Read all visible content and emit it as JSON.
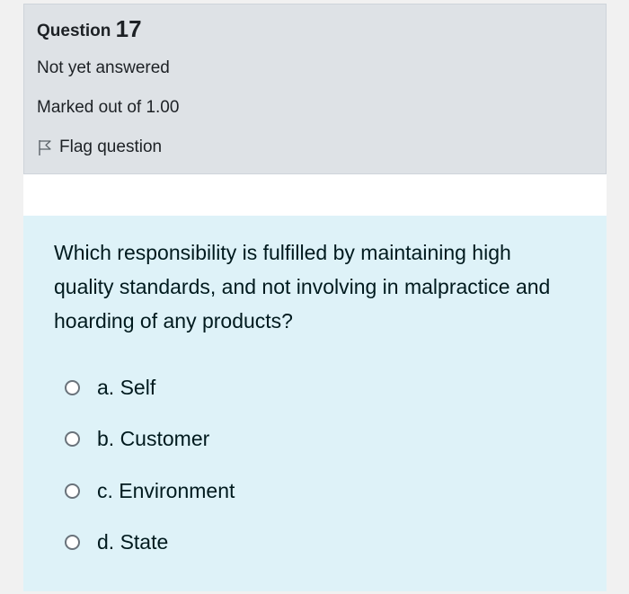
{
  "question": {
    "prefix": "Question",
    "number": "17",
    "state": "Not yet answered",
    "grade": "Marked out of 1.00",
    "flag_label": "Flag question"
  },
  "question_text": "Which responsibility is fulfilled by maintaining high quality standards, and not involving in malpractice and hoarding of any products?",
  "answers": [
    {
      "label": "a. Self",
      "selected": false
    },
    {
      "label": "b. Customer",
      "selected": false
    },
    {
      "label": "c. Environment",
      "selected": false
    },
    {
      "label": "d. State",
      "selected": false
    }
  ],
  "colors": {
    "info_bg": "#dee2e6",
    "formulation_bg": "#def2f8",
    "text": "#1d2125"
  }
}
